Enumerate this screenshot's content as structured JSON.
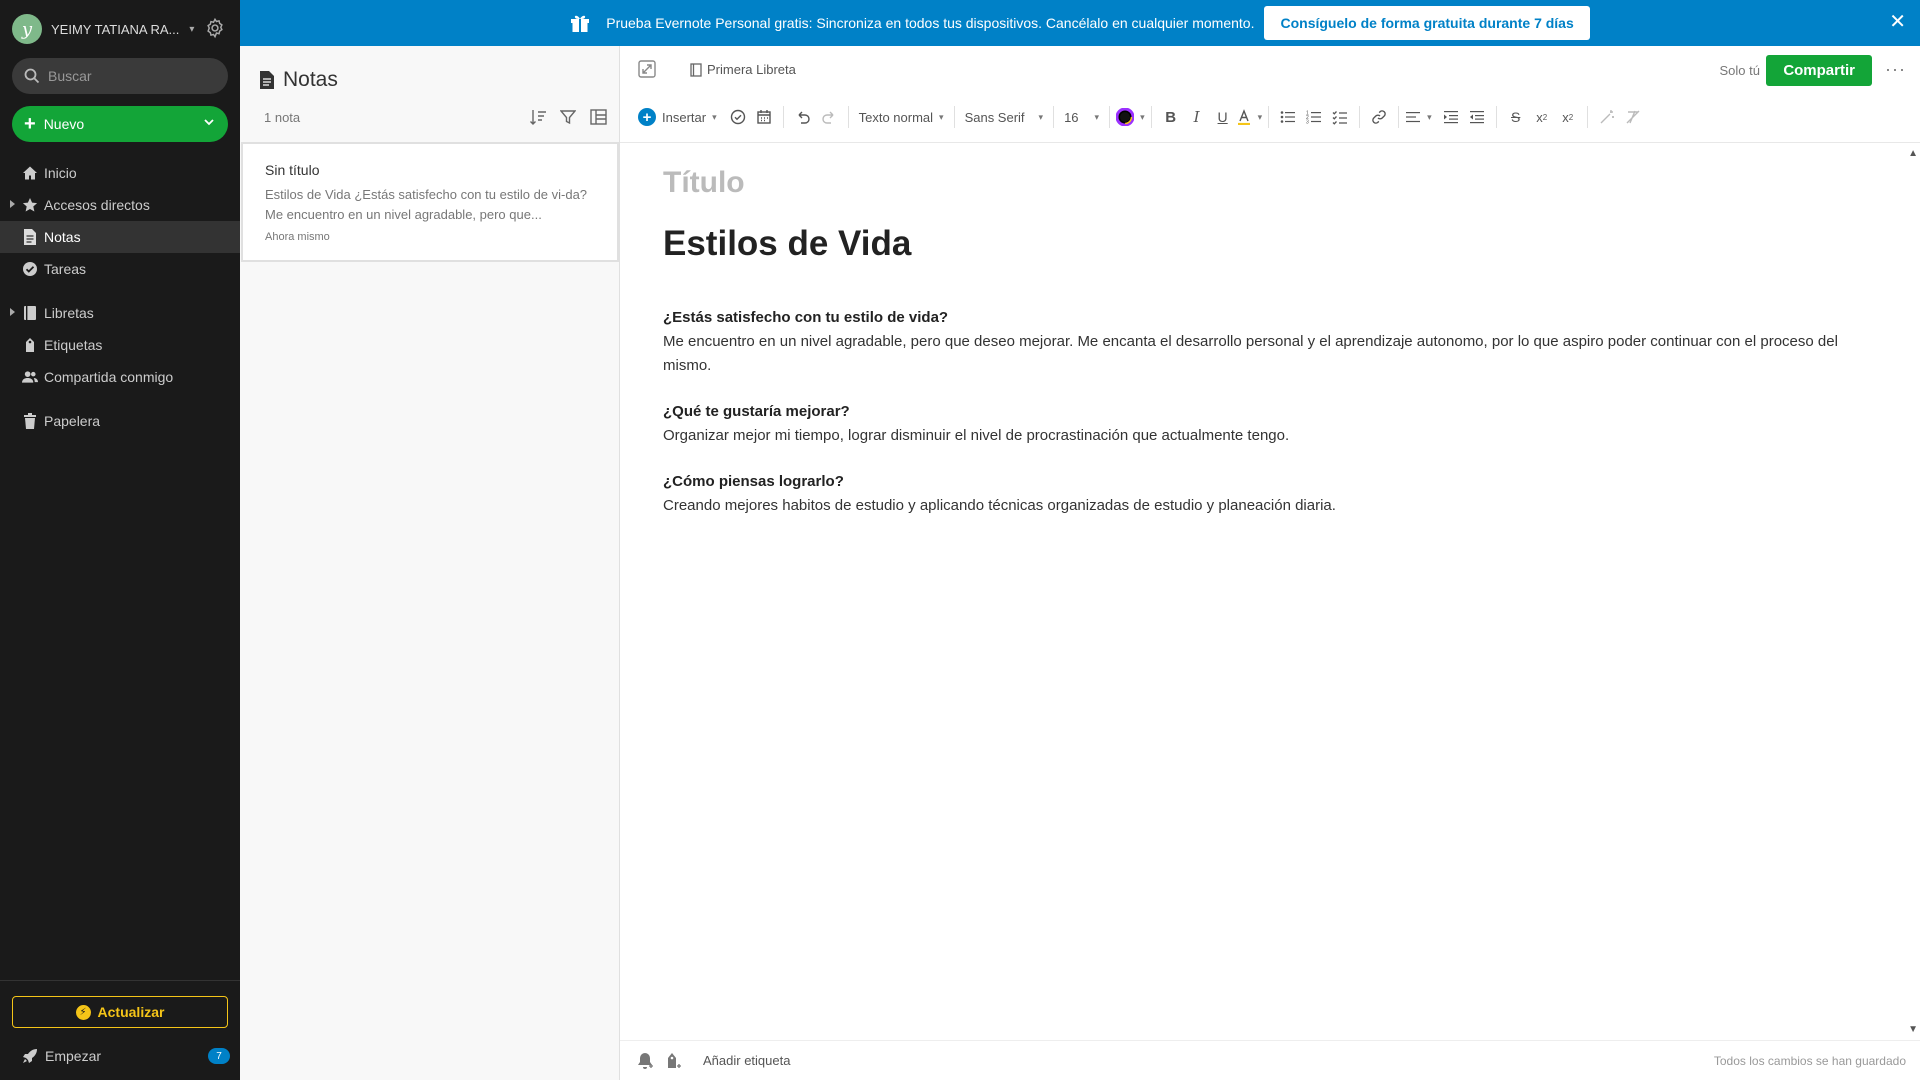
{
  "account": {
    "name": "YEIMY TATIANA RA...",
    "avatar_letter": "y"
  },
  "sidebar": {
    "search_placeholder": "Buscar",
    "new_label": "Nuevo",
    "items": [
      {
        "label": "Inicio",
        "icon": "home-icon"
      },
      {
        "label": "Accesos directos",
        "icon": "star-icon"
      },
      {
        "label": "Notas",
        "icon": "note-icon",
        "active": true
      },
      {
        "label": "Tareas",
        "icon": "check-circle-icon"
      },
      {
        "label": "Libretas",
        "icon": "notebook-icon"
      },
      {
        "label": "Etiquetas",
        "icon": "tag-icon"
      },
      {
        "label": "Compartida conmigo",
        "icon": "people-icon"
      },
      {
        "label": "Papelera",
        "icon": "trash-icon"
      }
    ],
    "upgrade_label": "Actualizar",
    "start_label": "Empezar",
    "start_badge": "7"
  },
  "banner": {
    "text": "Prueba Evernote Personal gratis:  Sincroniza en todos tus dispositivos. Cancélalo en cualquier momento.",
    "cta": "Consíguelo de forma gratuita durante 7 días",
    "close": "✕"
  },
  "notelist": {
    "title": "Notas",
    "count": "1 nota",
    "notes": [
      {
        "title": "Sin título",
        "snippet": "Estilos de Vida ¿Estás satisfecho con tu estilo de vi-da? Me encuentro en un nivel agradable, pero que...",
        "time": "Ahora mismo"
      }
    ]
  },
  "editor": {
    "notebook": "Primera Libreta",
    "visibility": "Solo tú",
    "share_label": "Compartir",
    "more": "···",
    "toolbar": {
      "insert": "Insertar",
      "text_style": "Texto normal",
      "font": "Sans Serif",
      "size": "16"
    },
    "title_placeholder": "Título",
    "heading": "Estilos de Vida",
    "qa": [
      {
        "q": "¿Estás satisfecho con tu estilo de vida?",
        "a": "Me encuentro en un nivel agradable, pero que deseo mejorar.  Me encanta el desarrollo personal y el aprendizaje autonomo, por lo que aspiro poder continuar con el proceso del mismo."
      },
      {
        "q": "¿Qué te gustaría mejorar?",
        "a": "Organizar mejor mi tiempo, lograr disminuir el nivel de procrastinación que actualmente tengo."
      },
      {
        "q": "¿Cómo piensas lograrlo?",
        "a": "Creando mejores habitos de estudio y aplicando técnicas organizadas de estudio y planeación diaria."
      }
    ],
    "add_tag": "Añadir etiqueta",
    "save_status": "Todos los cambios se han guardado"
  },
  "colors": {
    "sidebar_bg": "#1a1a1a",
    "brand_green": "#13a538",
    "banner_blue": "#0081c7",
    "upgrade_yellow": "#f5c518"
  }
}
